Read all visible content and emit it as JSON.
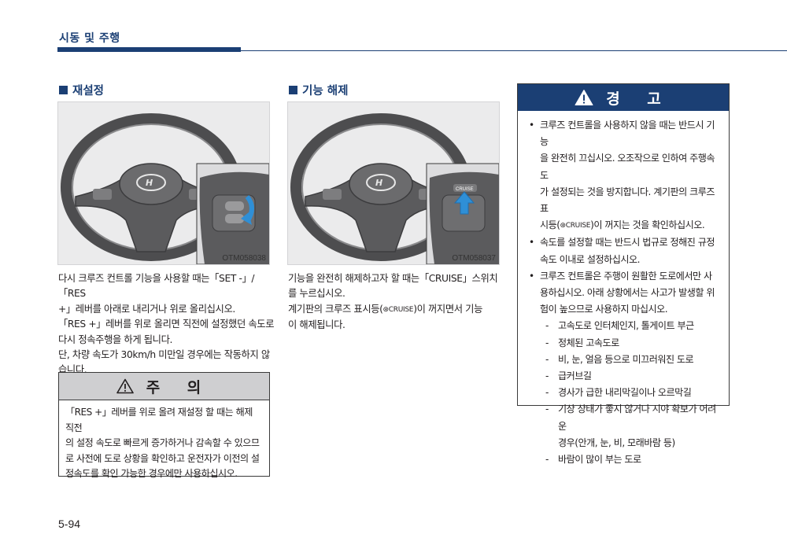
{
  "header": {
    "chapter_title": "시동 및 주행"
  },
  "resume": {
    "heading": "재설정",
    "figure_code": "OTM058038",
    "lines": [
      "다시 크루즈 컨트롤 기능을 사용할 때는「SET -」/「RES",
      "+」레버를 아래로 내리거나 위로 올리십시오.",
      "「RES +」레버를 위로 올리면 직전에 설정했던 속도로",
      "다시 정속주행을 하게 됩니다.",
      "단, 차량 속도가 30km/h 미만일 경우에는 작동하지 않",
      "습니다."
    ]
  },
  "caution": {
    "title": "주 의",
    "lines": [
      "「RES +」레버를 위로 올려 재설정 할 때는 해제 직전",
      "의 설정 속도로 빠르게 증가하거나 감속할 수 있으므",
      "로 사전에 도로 상황을 확인하고 운전자가 이전의 설",
      "정속도를 확인 가능한 경우에만 사용하십시오."
    ]
  },
  "cancel": {
    "heading": "기능 해제",
    "figure_code": "OTM058037",
    "button_label": "CRUISE",
    "lines": {
      "l1": "기능을 완전히 해제하고자 할 때는「CRUISE」스위치",
      "l2": "를 누르십시오.",
      "l3_before": "계기판의 크루즈 표시등(",
      "l3_icon": "CRUISE",
      "l3_after": ")이 꺼지면서 기능",
      "l4": "이 해제됩니다."
    }
  },
  "warning": {
    "title": "경 고",
    "bullet1": {
      "l1": "크루즈 컨트롤을 사용하지 않을 때는 반드시 기능",
      "l2": "을 완전히 끄십시오. 오조작으로 인하여 주행속도",
      "l3": "가 설정되는 것을 방지합니다. 계기판의 크루즈 표",
      "l4_before": "시등(",
      "l4_icon": "CRUISE",
      "l4_after": ")이 꺼지는 것을 확인하십시오."
    },
    "bullet2": [
      "속도를 설정할 때는 반드시 법규로 정해진 규정",
      "속도 이내로 설정하십시오."
    ],
    "bullet3": [
      "크루즈 컨트롤은 주행이 원활한 도로에서만 사",
      "용하십시오. 아래 상황에서는 사고가 발생할 위",
      "험이 높으므로 사용하지 마십시오."
    ],
    "situations": [
      [
        "고속도로 인터체인지, 톨게이트 부근"
      ],
      [
        "정체된 고속도로"
      ],
      [
        "비, 눈, 얼음 등으로 미끄러워진 도로"
      ],
      [
        "급커브길"
      ],
      [
        "경사가 급한 내리막길이나 오르막길"
      ],
      [
        "기상 상태가 좋지 않거나 시야 확보가 어려운",
        "경우(안개, 눈, 비, 모래바람 등)"
      ],
      [
        "바람이 많이 부는 도로"
      ]
    ]
  },
  "footer": {
    "page_number": "5-94"
  },
  "colors": {
    "brand_navy": "#1b3f74",
    "caution_gray": "#cfcfd1",
    "figure_bg": "#ebebec",
    "arrow_blue": "#2f8fd6"
  },
  "icons": [
    "warning-triangle-icon",
    "cruise-indicator-icon",
    "steering-wheel-illustration"
  ]
}
